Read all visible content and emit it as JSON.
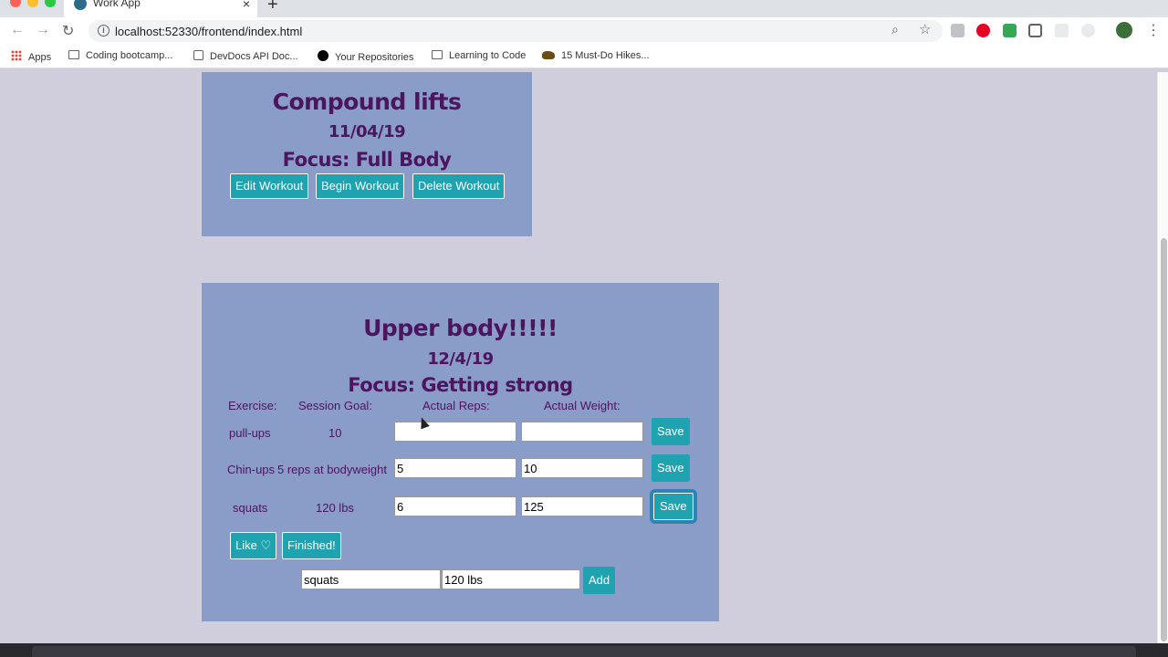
{
  "browser": {
    "tab_title": "Work App",
    "tab_close": "×",
    "new_tab": "+",
    "url": "localhost:52330/frontend/index.html",
    "info_glyph": "i",
    "back_glyph": "←",
    "forward_glyph": "→",
    "reload_glyph": "↻",
    "zoom_glyph": "⌕",
    "star_glyph": "☆",
    "menu_glyph": "⋮",
    "bookmarks": [
      {
        "label": "Apps",
        "icon": "apps-icon"
      },
      {
        "label": "Coding bootcamp...",
        "icon": "folder-icon"
      },
      {
        "label": "DevDocs API Doc...",
        "icon": "devdocs-icon"
      },
      {
        "label": "Your Repositories",
        "icon": "github-icon"
      },
      {
        "label": "Learning to Code",
        "icon": "folder-icon"
      },
      {
        "label": "15 Must-Do Hikes...",
        "icon": "bison-icon"
      }
    ]
  },
  "workouts": [
    {
      "name": "Compound lifts",
      "date": "11/04/19",
      "focus": "Focus: Full Body",
      "buttons": {
        "edit": "Edit Workout",
        "begin": "Begin Workout",
        "delete": "Delete Workout"
      }
    },
    {
      "name": "Upper body!!!!!",
      "date": "12/4/19",
      "focus": "Focus: Getting strong",
      "columns": [
        "Exercise:",
        "Session Goal:",
        "Actual Reps:",
        "Actual Weight:"
      ],
      "exercises": [
        {
          "exercise": "pull-ups",
          "goal": "10",
          "reps": "",
          "weight": ""
        },
        {
          "exercise": "Chin-ups",
          "goal": "5 reps at bodyweight",
          "reps": "5",
          "weight": "10"
        },
        {
          "exercise": "squats",
          "goal": "120 lbs",
          "reps": "6",
          "weight": "125"
        }
      ],
      "save_label": "Save",
      "like_label": "Like ♡",
      "finished_label": "Finished!",
      "add_form": {
        "exercise_value": "squats",
        "goal_value": "120 lbs",
        "add_label": "Add"
      }
    }
  ]
}
